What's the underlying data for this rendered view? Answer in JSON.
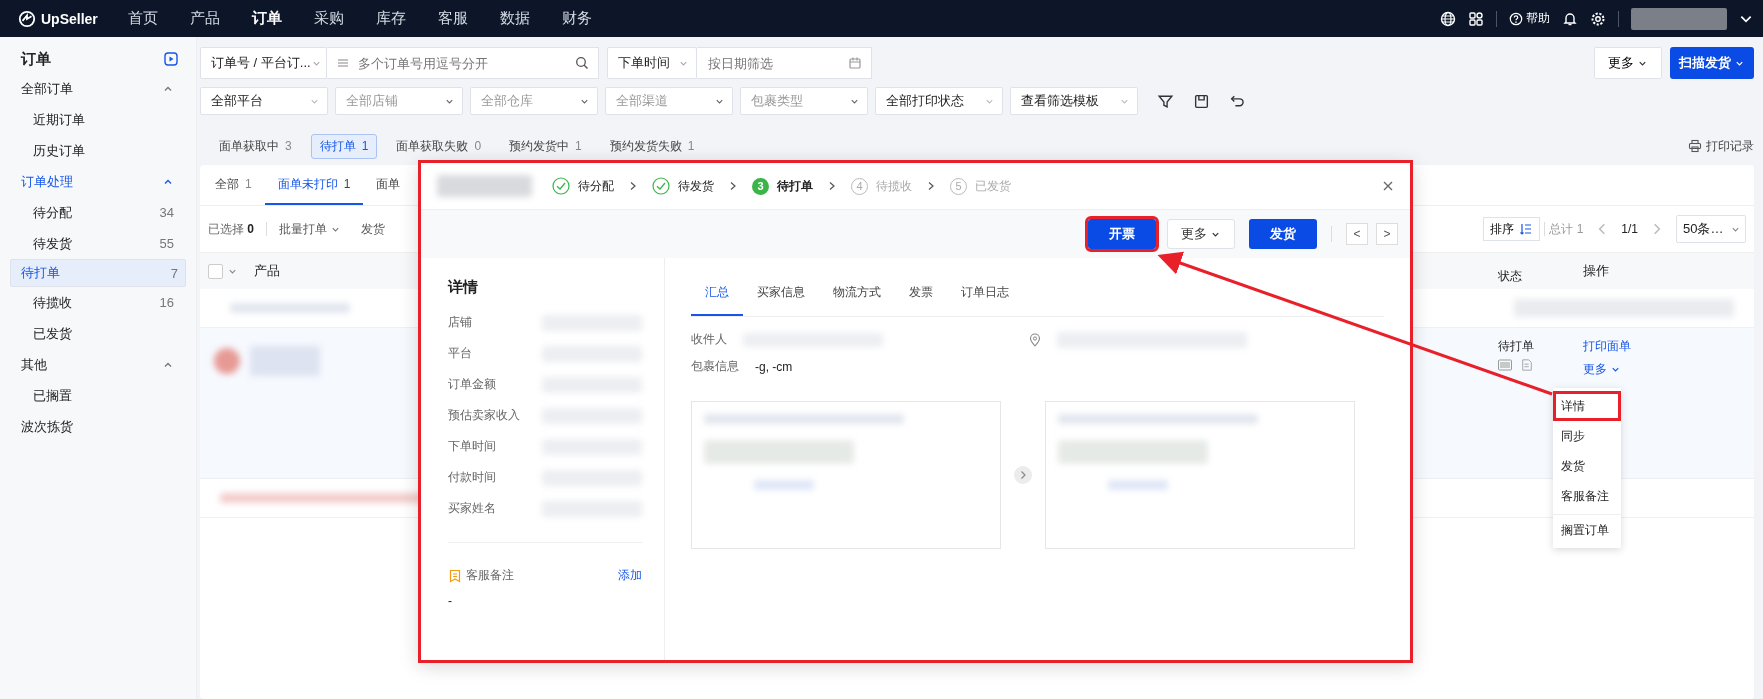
{
  "top_nav": {
    "logo": "UpSeller",
    "help": "帮助",
    "items": [
      {
        "label": "首页",
        "selected": false
      },
      {
        "label": "产品",
        "selected": false
      },
      {
        "label": "订单",
        "selected": true
      },
      {
        "label": "采购",
        "selected": false
      },
      {
        "label": "库存",
        "selected": false
      },
      {
        "label": "客服",
        "selected": false
      },
      {
        "label": "数据",
        "selected": false
      },
      {
        "label": "财务",
        "selected": false
      }
    ]
  },
  "sidebar": {
    "title": "订单",
    "groups": [
      {
        "kind": "group",
        "label": "全部订单",
        "active": false,
        "expanded": true,
        "children": [
          {
            "label": "近期订单",
            "selected": false
          },
          {
            "label": "历史订单",
            "selected": false
          }
        ]
      },
      {
        "kind": "group",
        "label": "订单处理",
        "active": true,
        "expanded": true,
        "children": [
          {
            "label": "待分配",
            "count": "34",
            "selected": false
          },
          {
            "label": "待发货",
            "count": "55",
            "selected": false
          },
          {
            "label": "待打单",
            "count": "7",
            "selected": true
          },
          {
            "label": "待揽收",
            "count": "16",
            "selected": false
          },
          {
            "label": "已发货",
            "selected": false
          }
        ]
      },
      {
        "kind": "group",
        "label": "其他",
        "active": false,
        "expanded": true,
        "children": [
          {
            "label": "已搁置",
            "selected": false
          }
        ]
      },
      {
        "kind": "link",
        "label": "波次拣货",
        "active": false
      }
    ]
  },
  "filters": {
    "search_type": "订单号 / 平台订...",
    "search_placeholder": "多个订单号用逗号分开",
    "time_type": "下单时间",
    "date_placeholder": "按日期筛选",
    "selects": [
      {
        "value": "全部平台"
      },
      {
        "placeholder": "全部店铺"
      },
      {
        "placeholder": "全部仓库"
      },
      {
        "placeholder": "全部渠道"
      },
      {
        "placeholder": "包裹类型"
      },
      {
        "value": "全部打印状态"
      },
      {
        "value": "查看筛选模板"
      }
    ],
    "more": "更多",
    "scan": "扫描发货"
  },
  "status_tabs": [
    {
      "label": "面单获取中",
      "count": "3",
      "selected": false
    },
    {
      "label": "待打单",
      "count": "1",
      "selected": true
    },
    {
      "label": "面单获取失败",
      "count": "0",
      "selected": false
    },
    {
      "label": "预约发货中",
      "count": "1",
      "selected": false
    },
    {
      "label": "预约发货失败",
      "count": "1",
      "selected": false
    }
  ],
  "print_log": "打印记录",
  "table": {
    "tabs": [
      {
        "label": "全部",
        "count": "1",
        "selected": false
      },
      {
        "label": "面单未打印",
        "count": "1",
        "selected": true
      },
      {
        "label": "面单",
        "selected": false
      }
    ],
    "selected_label": "已选择",
    "selected_count": "0",
    "batch": "批量打单",
    "ship": "发货",
    "sort": "排序",
    "total": "总计 1",
    "page": "1/1",
    "page_size": "50条…",
    "columns": [
      "产品",
      "状态",
      "操作"
    ],
    "select_all_checked": false,
    "row": {
      "status": "待打单",
      "action": "打印面单",
      "more": "更多",
      "menu": [
        {
          "label": "详情",
          "highlighted": true,
          "divider_before": false
        },
        {
          "label": "同步",
          "highlighted": false,
          "divider_before": false
        },
        {
          "label": "发货",
          "highlighted": false,
          "divider_before": false
        },
        {
          "label": "客服备注",
          "highlighted": false,
          "divider_before": false
        },
        {
          "label": "搁置订单",
          "highlighted": false,
          "divider_before": true
        }
      ]
    }
  },
  "modal": {
    "steps": [
      {
        "label": "待分配",
        "done": true,
        "current": false
      },
      {
        "label": "待发货",
        "done": true,
        "current": false
      },
      {
        "label": "待打单",
        "number": "3",
        "done": false,
        "current": true
      },
      {
        "label": "待揽收",
        "number": "4",
        "done": false,
        "current": false
      },
      {
        "label": "已发货",
        "number": "5",
        "done": false,
        "current": false
      }
    ],
    "buttons": [
      {
        "label": "开票",
        "kind": "primary",
        "highlighted": true
      },
      {
        "label": "更多",
        "kind": "dropdown",
        "highlighted": false
      },
      {
        "label": "发货",
        "kind": "primary",
        "highlighted": false
      }
    ],
    "prev": "<",
    "next": ">",
    "details_title": "详情",
    "fields": [
      "店铺",
      "平台",
      "订单金额",
      "预估卖家收入",
      "下单时间",
      "付款时间",
      "买家姓名"
    ],
    "note_label": "客服备注",
    "note_add": "添加",
    "note_value": "-",
    "tabs": [
      {
        "label": "汇总",
        "selected": true
      },
      {
        "label": "买家信息",
        "selected": false
      },
      {
        "label": "物流方式",
        "selected": false
      },
      {
        "label": "发票",
        "selected": false
      },
      {
        "label": "订单日志",
        "selected": false
      }
    ],
    "recipient_label": "收件人",
    "package_label": "包裹信息",
    "package_value": "-g, -cm"
  }
}
